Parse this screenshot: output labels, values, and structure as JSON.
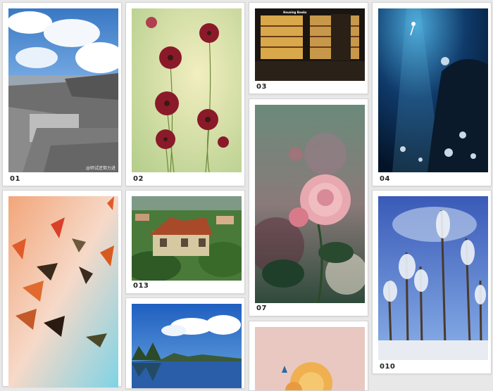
{
  "gallery": {
    "items": [
      {
        "id": "01",
        "caption": "01",
        "watermark": "@师试还努力进展"
      },
      {
        "id": "02",
        "caption": "02"
      },
      {
        "id": "03",
        "caption": "03",
        "shop_sign": "Housing Books"
      },
      {
        "id": "04",
        "caption": "04"
      },
      {
        "id": "05",
        "caption": ""
      },
      {
        "id": "013",
        "caption": "013"
      },
      {
        "id": "07",
        "caption": "07"
      },
      {
        "id": "010",
        "caption": "010"
      },
      {
        "id": "09",
        "caption": ""
      },
      {
        "id": "11",
        "caption": ""
      }
    ]
  },
  "colors": {
    "page_background": "#e8e8e8",
    "card_background": "#ffffff",
    "card_border": "#d4d4d4",
    "caption_text": "#222222"
  }
}
